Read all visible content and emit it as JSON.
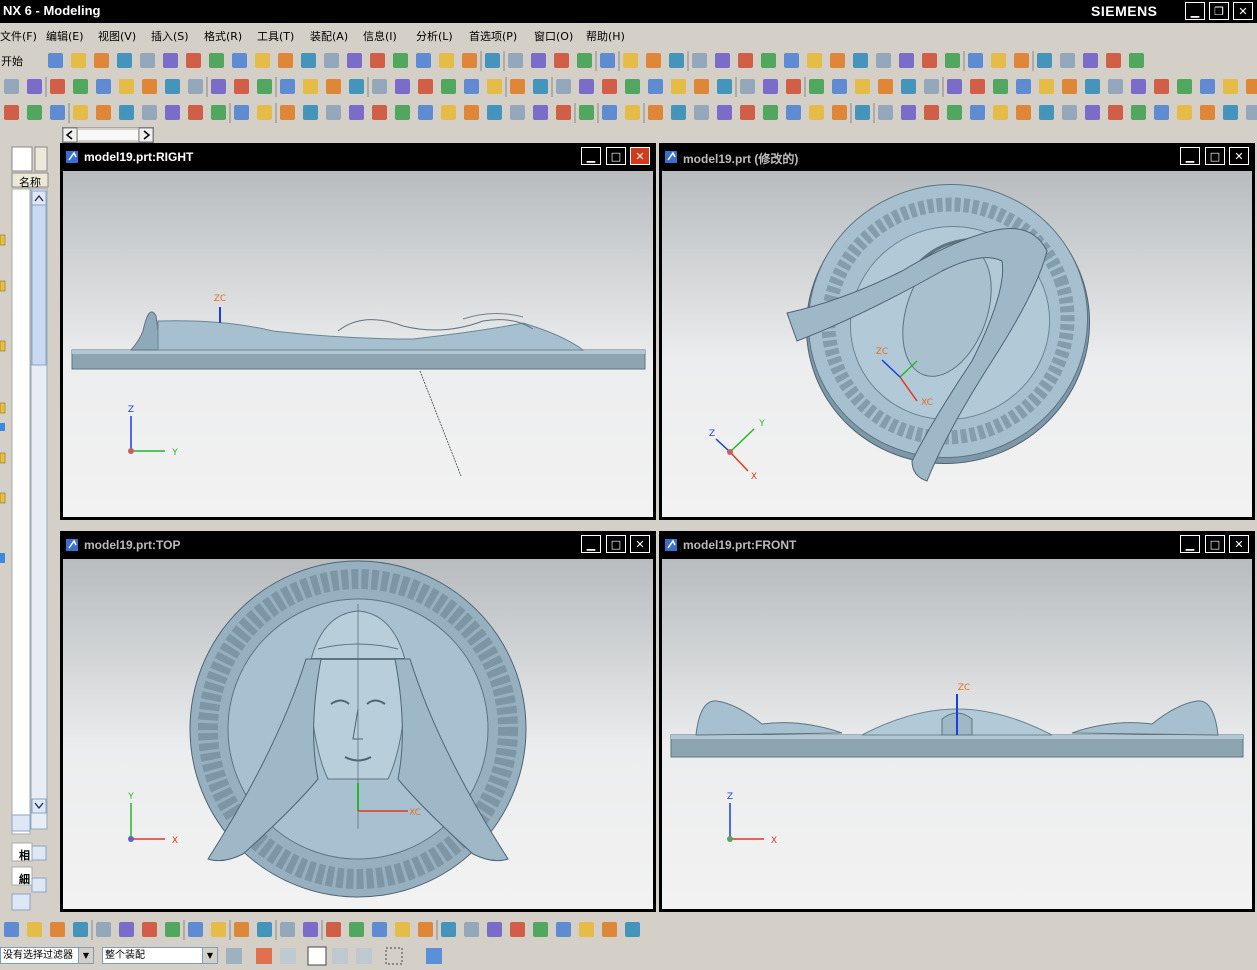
{
  "app": {
    "title": "NX 6 - Modeling",
    "brand": "SIEMENS"
  },
  "menu": [
    {
      "label": "文件(F)"
    },
    {
      "label": "编辑(E)"
    },
    {
      "label": "视图(V)"
    },
    {
      "label": "插入(S)"
    },
    {
      "label": "格式(R)"
    },
    {
      "label": "工具(T)"
    },
    {
      "label": "装配(A)"
    },
    {
      "label": "信息(I)"
    },
    {
      "label": "分析(L)"
    },
    {
      "label": "首选项(P)"
    },
    {
      "label": "窗口(O)"
    },
    {
      "label": "帮助(H)"
    }
  ],
  "toolbar": {
    "start_label": "开始"
  },
  "sidebar": {
    "column_header": "名称",
    "item1": "相",
    "item2": "細"
  },
  "viewports": [
    {
      "title": "model19.prt:RIGHT",
      "active": true
    },
    {
      "title": "model19.prt  (修改的)",
      "active": false
    },
    {
      "title": "model19.prt:TOP",
      "active": false
    },
    {
      "title": "model19.prt:FRONT",
      "active": false
    }
  ],
  "axes": {
    "zc": "ZC",
    "xc": "XC",
    "z": "Z",
    "y": "Y",
    "x": "X"
  },
  "status": {
    "filter": "没有选择过滤器",
    "scope": "整个装配"
  },
  "colors": {
    "title_bg": "#000000",
    "close_red": "#d23a1a",
    "model": "#9fb7c6",
    "axis_x": "#e8341c",
    "axis_y": "#23b823",
    "axis_z": "#1a3ee0"
  }
}
